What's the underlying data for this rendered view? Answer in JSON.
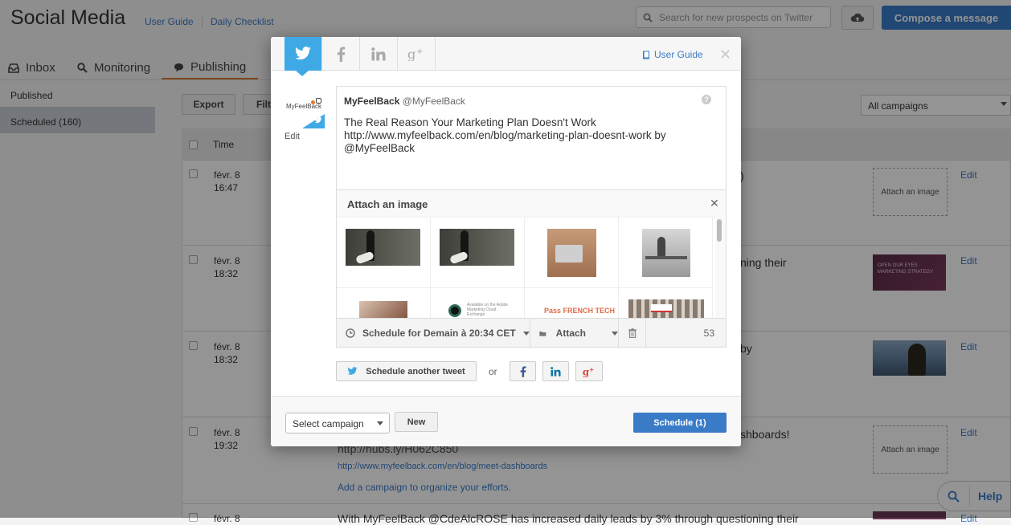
{
  "header": {
    "title": "Social Media",
    "links": [
      "User Guide",
      "Daily Checklist"
    ],
    "search_placeholder": "Search for new prospects on Twitter",
    "compose_label": "Compose a message"
  },
  "nav": {
    "tabs": [
      "Inbox",
      "Monitoring",
      "Publishing"
    ],
    "active": "Publishing"
  },
  "sidebar": {
    "items": [
      "Published",
      "Scheduled (160)"
    ]
  },
  "list": {
    "export_label": "Export",
    "filter_label": "Filt",
    "campaign_filter": "All campaigns",
    "time_header": "Time",
    "rows": [
      {
        "date": "févr. 8",
        "time": "16:47",
        "text": ")",
        "attach": "Attach an image",
        "edit": "Edit"
      },
      {
        "date": "févr. 8",
        "time": "18:32",
        "text": "ning their",
        "attach": "OPEN OUR EYES · MARKETING STRATEGY",
        "edit": "Edit"
      },
      {
        "date": "févr. 8",
        "time": "18:32",
        "text": "by",
        "attach": "",
        "edit": "Edit"
      },
      {
        "date": "févr. 8",
        "time": "19:32",
        "text": "shboards!",
        "attach": "Attach an image",
        "edit": "Edit"
      }
    ],
    "row4_link_partial": "http://hubs.ly/H062C850",
    "row4_url": "http://www.myfeelback.com/en/blog/meet-dashboards",
    "row4_campaign_hint": "Add a campaign to organize your efforts.",
    "row5_date": "févr. 8",
    "row5_text": "With MyFeelBack @CdeAlcROSE has increased daily leads by 3% through questioning their",
    "row5_edit": "Edit"
  },
  "modal": {
    "tabs": [
      "twitter-icon",
      "facebook-icon",
      "linkedin-icon",
      "googleplus-icon"
    ],
    "active_tab": "twitter",
    "user_guide": "User Guide",
    "avatar_label": "MyFeelBack",
    "avatar_edit": "Edit",
    "account_name": "MyFeelBack",
    "account_handle": "@MyFeelBack",
    "tweet_text": "The Real Reason Your Marketing Plan Doesn't Work\nhttp://www.myfeelback.com/en/blog/marketing-plan-doesnt-work by\n@MyFeelBack",
    "attach_title": "Attach an image",
    "thumbnail_alt": [
      "chess-pieces",
      "chess-pieces",
      "laptop-desk",
      "man-on-bench",
      "woman-portrait",
      "adobe-marketing-cloud-exchange",
      "pass-french-tech",
      "office-building"
    ],
    "thumb_texts": {
      "adobe": "Available on the Adobe Marketing Cloud Exchange",
      "pass": "Pass FRENCH TECH"
    },
    "schedule_label": "Schedule for Demain à 20:34 CET",
    "attach_label": "Attach",
    "char_count": "53",
    "schedule_another": "Schedule another tweet",
    "or_label": "or",
    "select_campaign": "Select campaign",
    "new_label": "New",
    "schedule_button": "Schedule (1)"
  },
  "help_widget": {
    "label": "Help"
  },
  "colors": {
    "accent": "#3a7bc8",
    "twitter": "#3fa9e6",
    "publishing_underline": "#d97b3a"
  }
}
